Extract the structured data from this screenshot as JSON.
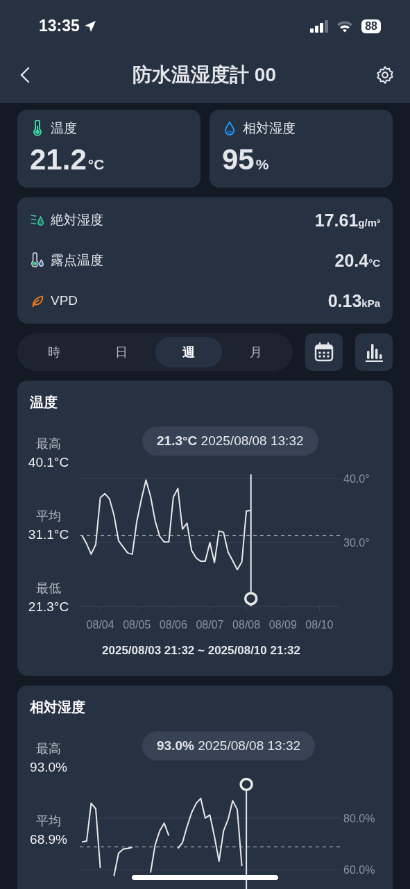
{
  "status_bar": {
    "time": "13:35",
    "battery": "88"
  },
  "nav": {
    "title": "防水温湿度計 00"
  },
  "summary": [
    {
      "kind": "temperature",
      "label": "温度",
      "value": "21.2",
      "unit": "°C"
    },
    {
      "kind": "humidity",
      "label": "相対湿度",
      "value": "95",
      "unit": "%"
    }
  ],
  "details": [
    {
      "kind": "absolute_humidity",
      "label": "絶対湿度",
      "value": "17.61",
      "unit": "g/m³"
    },
    {
      "kind": "dew_point",
      "label": "露点温度",
      "value": "20.4",
      "unit": "°C"
    },
    {
      "kind": "vpd",
      "label": "VPD",
      "value": "0.13",
      "unit": "kPa"
    }
  ],
  "periods": [
    {
      "label": "時",
      "selected": false
    },
    {
      "label": "日",
      "selected": false
    },
    {
      "label": "週",
      "selected": true
    },
    {
      "label": "月",
      "selected": false
    }
  ],
  "charts": [
    {
      "title": "温度",
      "stats": [
        {
          "label": "最高",
          "value": "40.1°C"
        },
        {
          "label": "平均",
          "value": "31.1°C"
        },
        {
          "label": "最低",
          "value": "21.3°C"
        }
      ],
      "tooltip": {
        "value": "21.3°C",
        "time": "2025/08/08 13:32"
      },
      "chart_data": {
        "type": "line",
        "categories": [
          null,
          null,
          null,
          null,
          "08/04",
          null,
          null,
          null,
          null,
          null,
          null,
          null,
          "08/05",
          null,
          null,
          null,
          null,
          null,
          null,
          null,
          "08/06",
          null,
          null,
          null,
          null,
          null,
          null,
          null,
          "08/07",
          null,
          null,
          null,
          null,
          null,
          null,
          null,
          "08/08",
          null,
          null,
          null,
          null,
          null,
          null,
          null,
          "08/09",
          null,
          null,
          null,
          null,
          null,
          null,
          null,
          "08/10",
          null,
          null,
          null,
          null
        ],
        "series": [
          {
            "color": "#e8e8e8",
            "values": [
              31.1,
              29.8,
              28.2,
              29.7,
              37.0,
              37.6,
              36.8,
              34.3,
              30.3,
              29.3,
              28.4,
              28.2,
              33.3,
              36.7,
              39.7,
              37.2,
              33.4,
              31.0,
              30.1,
              30.1,
              37.1,
              38.4,
              32.1,
              33.0,
              28.8,
              27.6,
              27.1,
              27.1,
              30.0,
              26.9,
              31.8,
              31.6,
              28.5,
              27.2,
              25.8,
              27.0,
              34.9,
              35.0,
              null,
              null,
              null,
              null,
              null,
              null,
              null,
              null,
              null,
              null,
              null,
              null,
              null,
              null,
              null,
              null,
              null,
              null,
              null
            ]
          },
          {
            "color": "#e8e8e8",
            "marker": "circle",
            "values": [
              null,
              null,
              null,
              null,
              null,
              null,
              null,
              null,
              null,
              null,
              null,
              null,
              null,
              null,
              null,
              null,
              null,
              null,
              null,
              null,
              null,
              null,
              null,
              null,
              null,
              null,
              null,
              null,
              null,
              null,
              null,
              null,
              null,
              null,
              null,
              null,
              null,
              21.3,
              null,
              null,
              null,
              null,
              null,
              null,
              null,
              null,
              null,
              null,
              null,
              null,
              null,
              null,
              null,
              null,
              null,
              null,
              null
            ]
          }
        ],
        "ylim": [
          20.1,
          40.6
        ],
        "yticks": [
          {
            "value": 30,
            "label": "30.0°"
          },
          {
            "value": 40,
            "label": "40.0°"
          }
        ],
        "ref_lines": [
          {
            "axis": "y",
            "value": 31.1
          }
        ]
      },
      "range": "2025/08/03 21:32 ~ 2025/08/10 21:32"
    },
    {
      "title": "相対湿度",
      "stats": [
        {
          "label": "最高",
          "value": "93.0%"
        },
        {
          "label": "平均",
          "value": "68.9%"
        }
      ],
      "tooltip": {
        "value": "93.0%",
        "time": "2025/08/08 13:32"
      },
      "chart_data": {
        "type": "line",
        "series": [
          {
            "color": "#e8e8e8",
            "values": [
              70.8,
              71.1,
              85.7,
              83.6,
              60.7,
              null,
              null,
              57.6,
              66.4,
              68.0,
              68.3,
              68.7,
              null,
              null,
              null,
              58.9,
              69.6,
              75.0,
              78.0,
              73.2,
              null,
              68.3,
              70.5,
              76.7,
              82.1,
              85.7,
              87.6,
              80.0,
              81.2,
              72.9,
              63.3,
              75.0,
              79.5,
              86.7,
              83.3,
              61.4,
              null,
              null,
              null,
              null,
              null,
              null,
              null,
              null,
              null,
              null,
              null,
              null,
              null,
              null,
              null,
              null,
              null,
              null,
              null,
              null,
              null
            ]
          },
          {
            "color": "#e8e8e8",
            "marker": "circle",
            "values": [
              null,
              null,
              null,
              null,
              null,
              null,
              null,
              null,
              null,
              null,
              null,
              null,
              null,
              null,
              null,
              null,
              null,
              null,
              null,
              null,
              null,
              null,
              null,
              null,
              null,
              null,
              null,
              null,
              null,
              null,
              null,
              null,
              null,
              null,
              null,
              null,
              93.0,
              null,
              null,
              null,
              null,
              null,
              null,
              null,
              null,
              null,
              null,
              null,
              null,
              null,
              null,
              null,
              null,
              null,
              null,
              null,
              null
            ]
          }
        ],
        "ylim": [
          44,
          95
        ],
        "yticks": [
          {
            "value": 60,
            "label": "60.0%"
          },
          {
            "value": 80,
            "label": "80.0%"
          }
        ],
        "ref_lines": [
          {
            "axis": "y",
            "value": 68.9
          }
        ]
      }
    }
  ]
}
